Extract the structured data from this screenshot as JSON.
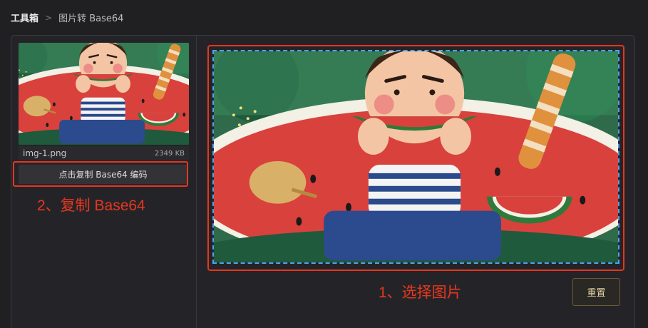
{
  "breadcrumb": {
    "root": "工具箱",
    "current": "图片转 Base64"
  },
  "file": {
    "name": "img-1.png",
    "size": "2349 KB"
  },
  "actions": {
    "copy_label": "点击复制 Base64 编码",
    "reset_label": "重置"
  },
  "annotations": {
    "step1": "1、选择图片",
    "step2": "2、复制 Base64"
  },
  "colors": {
    "accent_red": "#e8361f",
    "dashed_blue": "#4ea2f0",
    "background": "#202023"
  }
}
